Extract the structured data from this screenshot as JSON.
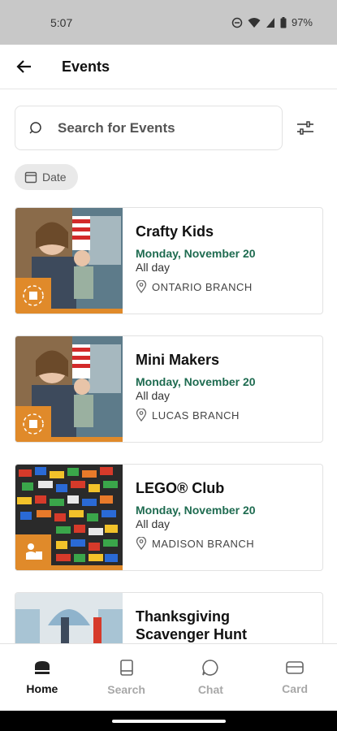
{
  "status_bar": {
    "time": "5:07",
    "battery": "97%"
  },
  "header": {
    "title": "Events"
  },
  "search": {
    "placeholder": "Search for Events"
  },
  "filters": {
    "date_chip": "Date"
  },
  "events": [
    {
      "title": "Crafty Kids",
      "date": "Monday, November 20",
      "time": "All day",
      "location": "ONTARIO BRANCH"
    },
    {
      "title": "Mini Makers",
      "date": "Monday, November 20",
      "time": "All day",
      "location": "LUCAS BRANCH"
    },
    {
      "title": "LEGO® Club",
      "date": "Monday, November 20",
      "time": "All day",
      "location": "MADISON BRANCH"
    },
    {
      "title_line1": "Thanksgiving",
      "title_line2": "Scavenger Hunt"
    }
  ],
  "bottom_nav": [
    {
      "label": "Home",
      "icon": "home-icon",
      "active": true
    },
    {
      "label": "Search",
      "icon": "book-icon",
      "active": false
    },
    {
      "label": "Chat",
      "icon": "chat-icon",
      "active": false
    },
    {
      "label": "Card",
      "icon": "card-icon",
      "active": false
    }
  ],
  "colors": {
    "accent_green": "#1e6b50",
    "badge_orange": "#e08a2a",
    "status_bar": "#c8c8c8"
  }
}
